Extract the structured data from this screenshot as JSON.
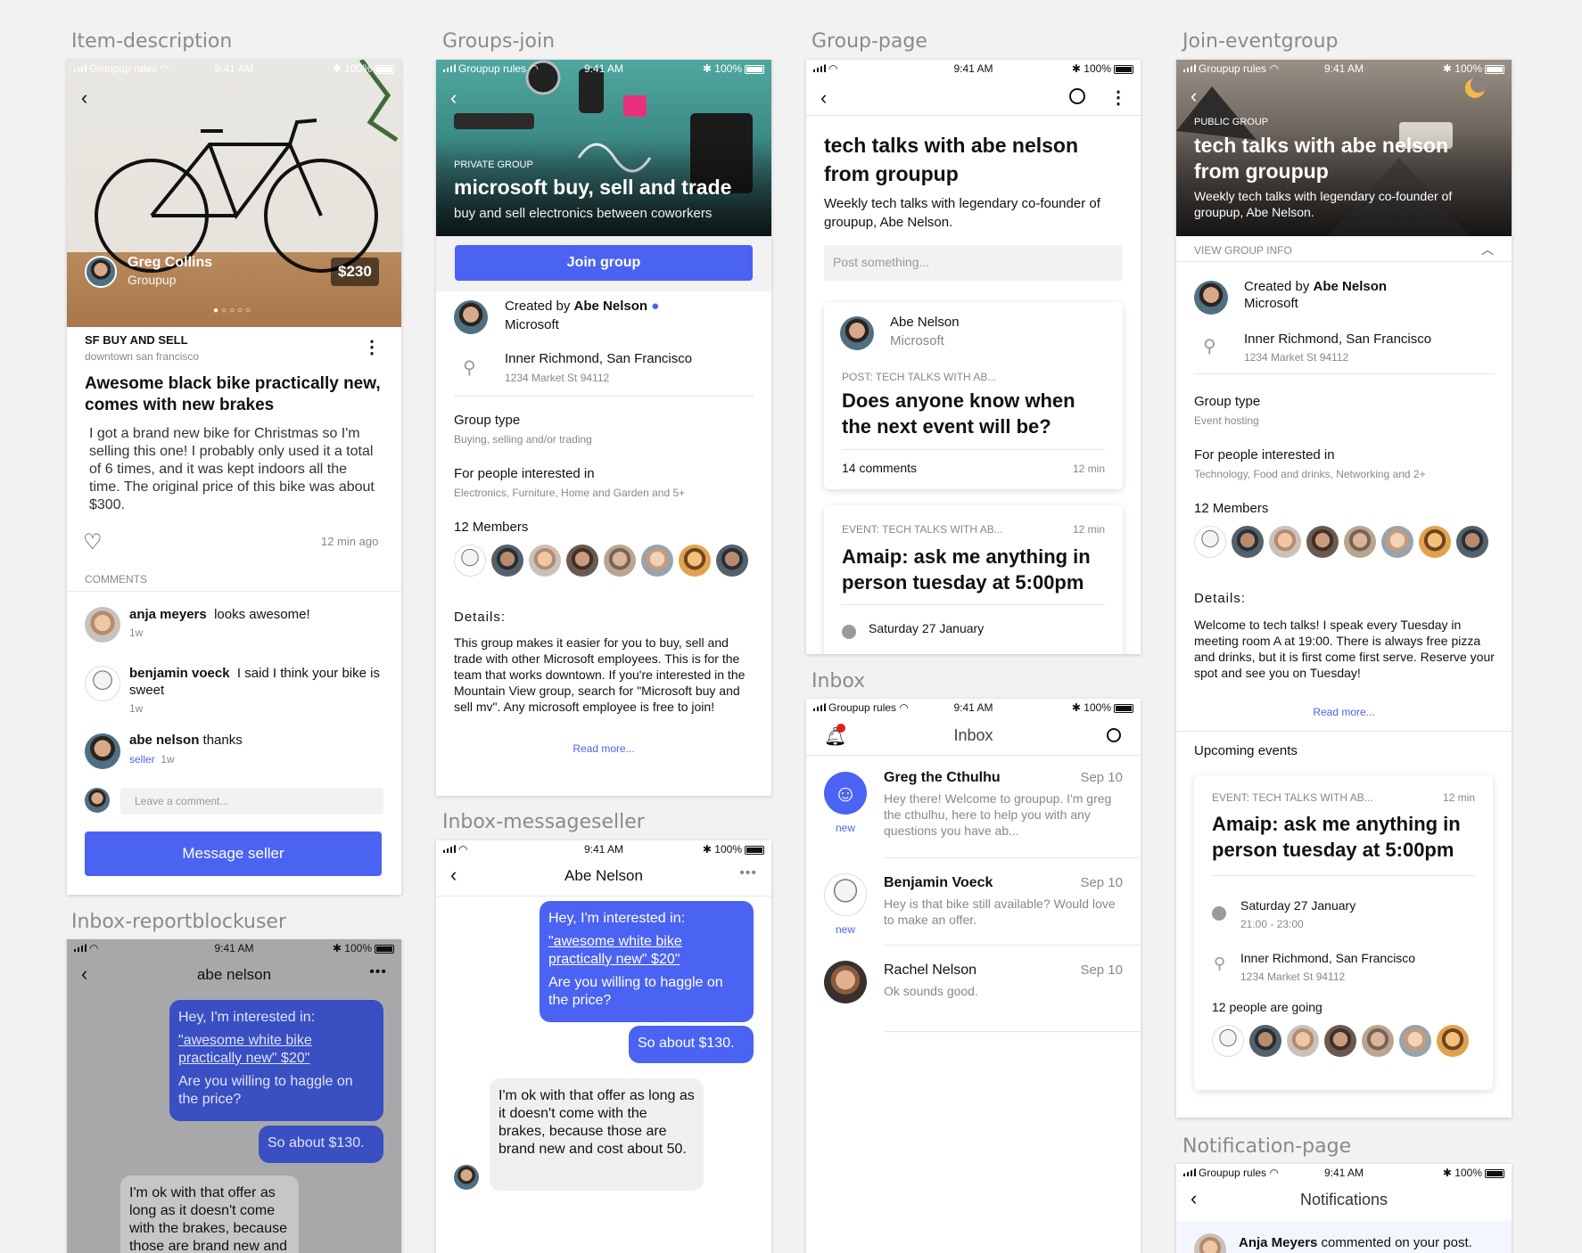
{
  "screen_labels": {
    "item_description": "Item-description",
    "groups_join": "Groups-join",
    "group_page": "Group-page",
    "join_eventgroup": "Join-eventgroup",
    "inbox_reportblockuser": "Inbox-reportblockuser",
    "inbox_messageseller": "Inbox-messageseller",
    "inbox": "Inbox",
    "notification_page": "Notification-page"
  },
  "status": {
    "carrier": "Groupup rules",
    "time": "9:41 AM",
    "battery": "100%"
  },
  "item": {
    "seller_name": "Greg Collins",
    "seller_sub": "Groupup",
    "price": "$230",
    "group": "SF BUY AND SELL",
    "location": "downtown san francisco",
    "title": "Awesome black bike practically new, comes with new brakes",
    "description": "I got a brand new bike for Christmas so I'm selling this one! I probably only used it a total of 6 times, and it was kept indoors all the time. The original price of this bike was about $300.",
    "time": "12 min ago",
    "comments_header": "COMMENTS",
    "comments": [
      {
        "name": "anja meyers",
        "text": "looks awesome!",
        "meta": "1w"
      },
      {
        "name": "benjamin voeck",
        "text": "I said I think your bike is sweet",
        "meta": "1w"
      },
      {
        "name": "abe nelson",
        "text": "thanks",
        "badge": "seller",
        "meta": "1w"
      }
    ],
    "comment_placeholder": "Leave a comment...",
    "message_button": "Message seller"
  },
  "groups_join": {
    "tag": "PRIVATE GROUP",
    "title": "microsoft buy, sell and trade",
    "subtitle": "buy and sell electronics between coworkers",
    "join_button": "Join group",
    "created_by_prefix": "Created by",
    "creator": "Abe Nelson",
    "creator_org": "Microsoft",
    "place": "Inner Richmond, San Francisco",
    "address": "1234 Market St 94112",
    "type_label": "Group type",
    "type_value": "Buying, selling and/or trading",
    "interest_label": "For people interested in",
    "interest_value": "Electronics, Furniture, Home and Garden and 5+",
    "members": "12 Members",
    "details_label": "Details:",
    "details": "This group makes it easier for you to buy, sell and trade with other Microsoft employees. This is for the team that works downtown. If you're interested in the Mountain View group, search for \"Microsoft buy and sell mv\". Any microsoft employee is free to join!",
    "read_more": "Read more..."
  },
  "group_page": {
    "title": "tech talks with abe nelson from groupup",
    "subtitle": "Weekly tech talks with legendary co-founder of groupup, Abe Nelson.",
    "post_placeholder": "Post something...",
    "post": {
      "author": "Abe Nelson",
      "org": "Microsoft",
      "tag": "POST: TECH TALKS WITH AB...",
      "title": "Does anyone know when the next event will be?",
      "comments": "14 comments",
      "time": "12 min"
    },
    "event": {
      "tag": "EVENT: TECH TALKS WITH AB...",
      "time": "12 min",
      "title": "Amaip: ask me anything in person tuesday at 5:00pm",
      "date": "Saturday 27 January"
    }
  },
  "join_event": {
    "tag": "PUBLIC GROUP",
    "title": "tech talks with abe nelson from groupup",
    "subtitle": "Weekly tech talks with legendary co-founder of groupup, Abe Nelson.",
    "view_info": "VIEW GROUP INFO",
    "created_by_prefix": "Created by",
    "creator": "Abe Nelson",
    "creator_org": "Microsoft",
    "place": "Inner Richmond, San Francisco",
    "address": "1234 Market St 94112",
    "type_label": "Group type",
    "type_value": "Event hosting",
    "interest_label": "For people interested in",
    "interest_value": "Technology, Food and drinks, Networking and 2+",
    "members": "12 Members",
    "details_label": "Details:",
    "details": "Welcome to tech talks! I speak every Tuesday in meeting room A at 19:00. There is always free pizza and drinks, but it is first come first serve. Reserve your spot and see you on Tuesday!",
    "read_more": "Read more...",
    "upcoming": "Upcoming events",
    "event": {
      "tag": "EVENT: TECH TALKS WITH AB...",
      "time": "12 min",
      "title": "Amaip: ask me anything in person tuesday at 5:00pm",
      "date": "Saturday 27 January",
      "hours": "21:00 - 23:00",
      "place": "Inner Richmond, San Francisco",
      "address": "1234 Market St 94112",
      "going": "12 people are going"
    }
  },
  "report": {
    "name": "abe nelson",
    "msg1_intro": "Hey, I'm interested in:",
    "msg1_link": "\"awesome white bike practically new\" $20\"",
    "msg1_q": "Are you willing to haggle on the price?",
    "msg2": "So about $130.",
    "msg3": "I'm ok with that offer as long as it doesn't come with the brakes, because those are brand new and cost"
  },
  "messageseller": {
    "name": "Abe Nelson",
    "msg1_intro": "Hey, I'm interested in:",
    "msg1_link": "\"awesome white bike practically new\" $20\"",
    "msg1_q": "Are you willing to haggle on the price?",
    "msg2": "So about $130.",
    "msg3": "I'm ok with that offer as long as it doesn't come with the brakes, because those are brand new and cost about 50."
  },
  "inbox": {
    "title": "Inbox",
    "threads": [
      {
        "name": "Greg the Cthulhu",
        "date": "Sep 10",
        "text": "Hey there! Welcome to groupup. I'm greg the cthulhu, here to help you with any questions you have ab...",
        "badge": "new"
      },
      {
        "name": "Benjamin Voeck",
        "date": "Sep 10",
        "text": "Hey is that bike still available? Would love to make an offer.",
        "badge": "new"
      },
      {
        "name": "Rachel Nelson",
        "date": "Sep 10",
        "text": "Ok sounds good.",
        "badge": ""
      }
    ]
  },
  "notifications": {
    "title": "Notifications",
    "first_name": "Anja Meyers",
    "first_text": "commented on your post."
  },
  "colors": {
    "accent": "#4b63f2",
    "notification_dot": "#e02020"
  }
}
